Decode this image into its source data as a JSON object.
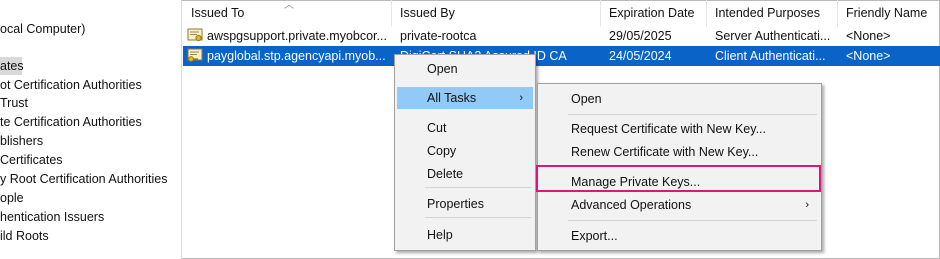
{
  "tree": {
    "items": [
      {
        "label": "ocal Computer)"
      },
      {
        "label": "ates"
      },
      {
        "label": "ot Certification Authorities"
      },
      {
        "label": "Trust"
      },
      {
        "label": "te Certification Authorities"
      },
      {
        "label": "blishers"
      },
      {
        "label": "Certificates"
      },
      {
        "label": "y Root Certification Authorities"
      },
      {
        "label": "ople"
      },
      {
        "label": "hentication Issuers"
      },
      {
        "label": "ild Roots"
      }
    ]
  },
  "columns": [
    "Issued To",
    "Issued By",
    "Expiration Date",
    "Intended Purposes",
    "Friendly Name"
  ],
  "rows": [
    {
      "issued_to": "awspgsupport.private.myobcor...",
      "issued_by": "private-rootca",
      "expiration": "29/05/2025",
      "purposes": "Server Authenticati...",
      "friendly": "<None>",
      "icon": "certificate-icon"
    },
    {
      "issued_to": "payglobal.stp.agencyapi.myob...",
      "issued_by": "DigiCert SHA2 Assured ID CA",
      "expiration": "24/05/2024",
      "purposes": "Client Authenticati...",
      "friendly": "<None>",
      "icon": "certificate-key-icon"
    }
  ],
  "context_menu": {
    "open": "Open",
    "all_tasks": "All Tasks",
    "cut": "Cut",
    "copy": "Copy",
    "delete": "Delete",
    "properties": "Properties",
    "help": "Help"
  },
  "submenu": {
    "open": "Open",
    "request_new_key": "Request Certificate with New Key...",
    "renew_new_key": "Renew Certificate with New Key...",
    "manage_private_keys": "Manage Private Keys...",
    "advanced_operations": "Advanced Operations",
    "export": "Export..."
  },
  "colors": {
    "selection": "#0a64c8",
    "menu_highlight": "#91c9f7",
    "callout": "#e0157a"
  }
}
